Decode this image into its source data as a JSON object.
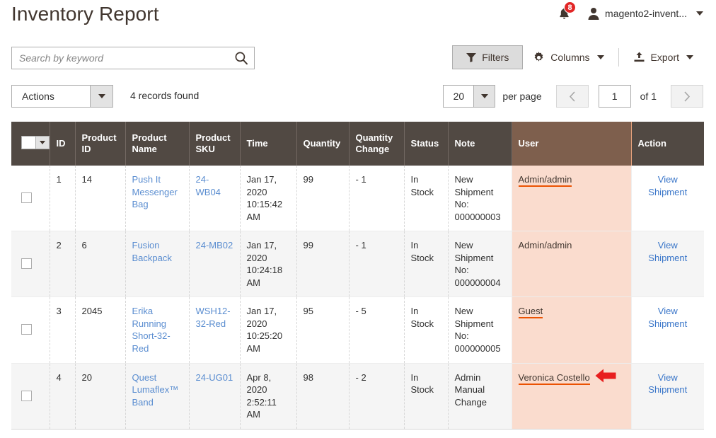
{
  "header": {
    "title": "Inventory Report",
    "notifications_count": "8",
    "user_name": "magento2-invent...",
    "bell_icon": "bell-icon",
    "avatar_icon": "user-avatar-icon",
    "caret_icon": "chevron-down-icon"
  },
  "search": {
    "placeholder": "Search by keyword",
    "value": "",
    "icon": "search-icon"
  },
  "toolbar": {
    "filters_label": "Filters",
    "filters_icon": "funnel-icon",
    "columns_label": "Columns",
    "columns_icon": "gear-icon",
    "export_label": "Export",
    "export_icon": "upload-icon"
  },
  "actions": {
    "label": "Actions",
    "caret_icon": "chevron-down-icon"
  },
  "records_found": "4 records found",
  "pager": {
    "per_page_value": "20",
    "per_page_label": "per page",
    "prev_icon": "chevron-left-icon",
    "next_icon": "chevron-right-icon",
    "current_page": "1",
    "of_label": "of 1"
  },
  "table": {
    "select_all_icon": "checkbox-dropdown-icon",
    "columns": [
      "",
      "ID",
      "Product ID",
      "Product Name",
      "Product SKU",
      "Time",
      "Quantity",
      "Quantity Change",
      "Status",
      "Note",
      "User",
      "Action"
    ],
    "highlighted_column": "User",
    "highlight_color": "#fadcce",
    "highlight_header_color": "#7e5f4d",
    "accent_color": "#eb5202",
    "rows": [
      {
        "id": "1",
        "product_id": "14",
        "product_name": "Push It Messenger Bag",
        "product_sku": "24-WB04",
        "time": "Jan 17, 2020 10:15:42 AM",
        "quantity": "99",
        "quantity_change": "- 1",
        "status": "In Stock",
        "note": "New Shipment No: 000000003",
        "user": "Admin/admin",
        "user_underlined": true,
        "action": "View Shipment"
      },
      {
        "id": "2",
        "product_id": "6",
        "product_name": "Fusion Backpack",
        "product_sku": "24-MB02",
        "time": "Jan 17, 2020 10:24:18 AM",
        "quantity": "99",
        "quantity_change": "- 1",
        "status": "In Stock",
        "note": "New Shipment No: 000000004",
        "user": "Admin/admin",
        "user_underlined": false,
        "action": "View Shipment"
      },
      {
        "id": "3",
        "product_id": "2045",
        "product_name": "Erika Running Short-32-Red",
        "product_sku": "WSH12-32-Red",
        "time": "Jan 17, 2020 10:25:20 AM",
        "quantity": "95",
        "quantity_change": "- 5",
        "status": "In Stock",
        "note": "New Shipment No: 000000005",
        "user": "Guest",
        "user_underlined": true,
        "action": "View Shipment"
      },
      {
        "id": "4",
        "product_id": "20",
        "product_name": "Quest Lumaflex™ Band",
        "product_sku": "24-UG01",
        "time": "Apr 8, 2020 2:52:11 AM",
        "quantity": "98",
        "quantity_change": "- 2",
        "status": "In Stock",
        "note": "Admin Manual Change",
        "user": "Veronica Costello",
        "user_underlined": true,
        "action": "View Shipment"
      }
    ]
  },
  "annotation": {
    "arrow_icon": "red-left-arrow-annotation",
    "color": "#e81f1f",
    "points_at": "Veronica Costello"
  }
}
